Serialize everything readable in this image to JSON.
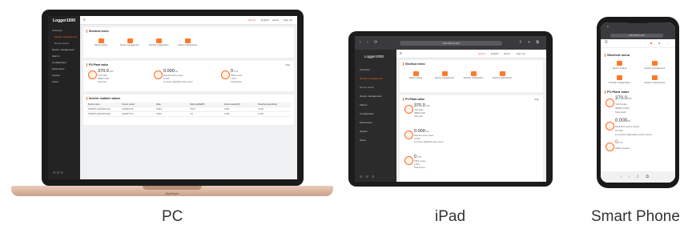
{
  "captions": {
    "pc": "PC",
    "ipad": "iPad",
    "phone": "Smart Phone"
  },
  "laptop": {
    "brand": "MacBook"
  },
  "app": {
    "logo": "Logger1000",
    "sidebar_items": [
      {
        "label": "Overview",
        "sub": false,
        "active": false
      },
      {
        "label": "Monitor management",
        "sub": true,
        "active": true
      },
      {
        "label": "Device status",
        "sub": true,
        "active": false
      },
      {
        "label": "Device management",
        "sub": false,
        "active": false
      },
      {
        "label": "Alarms",
        "sub": false,
        "active": false
      },
      {
        "label": "Configuration",
        "sub": false,
        "active": false
      },
      {
        "label": "Parameters",
        "sub": false,
        "active": false
      },
      {
        "label": "System",
        "sub": false,
        "active": false
      },
      {
        "label": "About",
        "sub": false,
        "active": false
      }
    ],
    "top_right": [
      "alarms",
      "English",
      "admin",
      "Sign out"
    ],
    "shortcut_title": "Shortcut menu",
    "shortcuts": [
      "Device setting",
      "Device management",
      "Transfer configuration",
      "System maintenance"
    ],
    "pv_title": "PV-Plant value",
    "pv_filter": "Day",
    "pv_items": [
      {
        "value": "370.0",
        "unit": "kWh",
        "label1": "Yield today",
        "label2": "38982.0 kWh",
        "label3": "Total yield"
      },
      {
        "value": "0.000",
        "unit": "kW",
        "label1": "Real-time active power",
        "label2": "0.0 kW",
        "label3": "kv inverter adjustable active power"
      },
      {
        "value": "0",
        "unit": "PCS",
        "label1": "Offline device",
        "label2": "1 PCS",
        "label3": "Total devices"
      }
    ],
    "table_title": "Inverter realtime values",
    "table_headers": [
      "Device name",
      "Device model",
      "State",
      "Daily yield(kWh)",
      "Active power(kW)",
      "Reactive power(kvar)"
    ],
    "table_rows": [
      [
        "SG60KTL-M(COM1-001)",
        "SG60KTL-M",
        "Online",
        "370.0",
        "0.000",
        "0.000"
      ],
      [
        "SG60KTL-M(COM1-002)",
        "SG60KTL-M",
        "Online",
        "0.0",
        "0.000",
        "0.000"
      ]
    ],
    "url": "192.168.10.1/#/"
  }
}
